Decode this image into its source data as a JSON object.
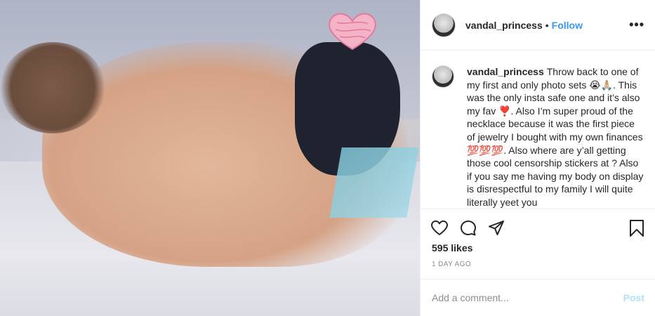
{
  "header": {
    "username": "vandal_princess",
    "separator": "•",
    "follow_label": "Follow",
    "more_label": "•••"
  },
  "caption": {
    "username": "vandal_princess",
    "text": "Throw back to one of my first and only photo sets 😭🙏🏼. This was the only insta safe one and it’s also my fav ❣️. Also I’m super proud of the necklace because it was the first piece of jewelry I bought with my own finances 💯💯💯. Also where are y’all getting those cool censorship stickers at ? Also if you say me having my body on display is disrespectful to my family I will quite literally yeet you"
  },
  "actions": {
    "like_icon": "heart-icon",
    "comment_icon": "comment-icon",
    "share_icon": "share-icon",
    "save_icon": "bookmark-icon"
  },
  "likes": "595 likes",
  "timestamp": "1 DAY AGO",
  "comment": {
    "placeholder": "Add a comment...",
    "post_label": "Post"
  },
  "colors": {
    "link": "#3897f0",
    "post_disabled": "#b2dffc",
    "muted": "#8e8e8e",
    "text": "#262626"
  }
}
